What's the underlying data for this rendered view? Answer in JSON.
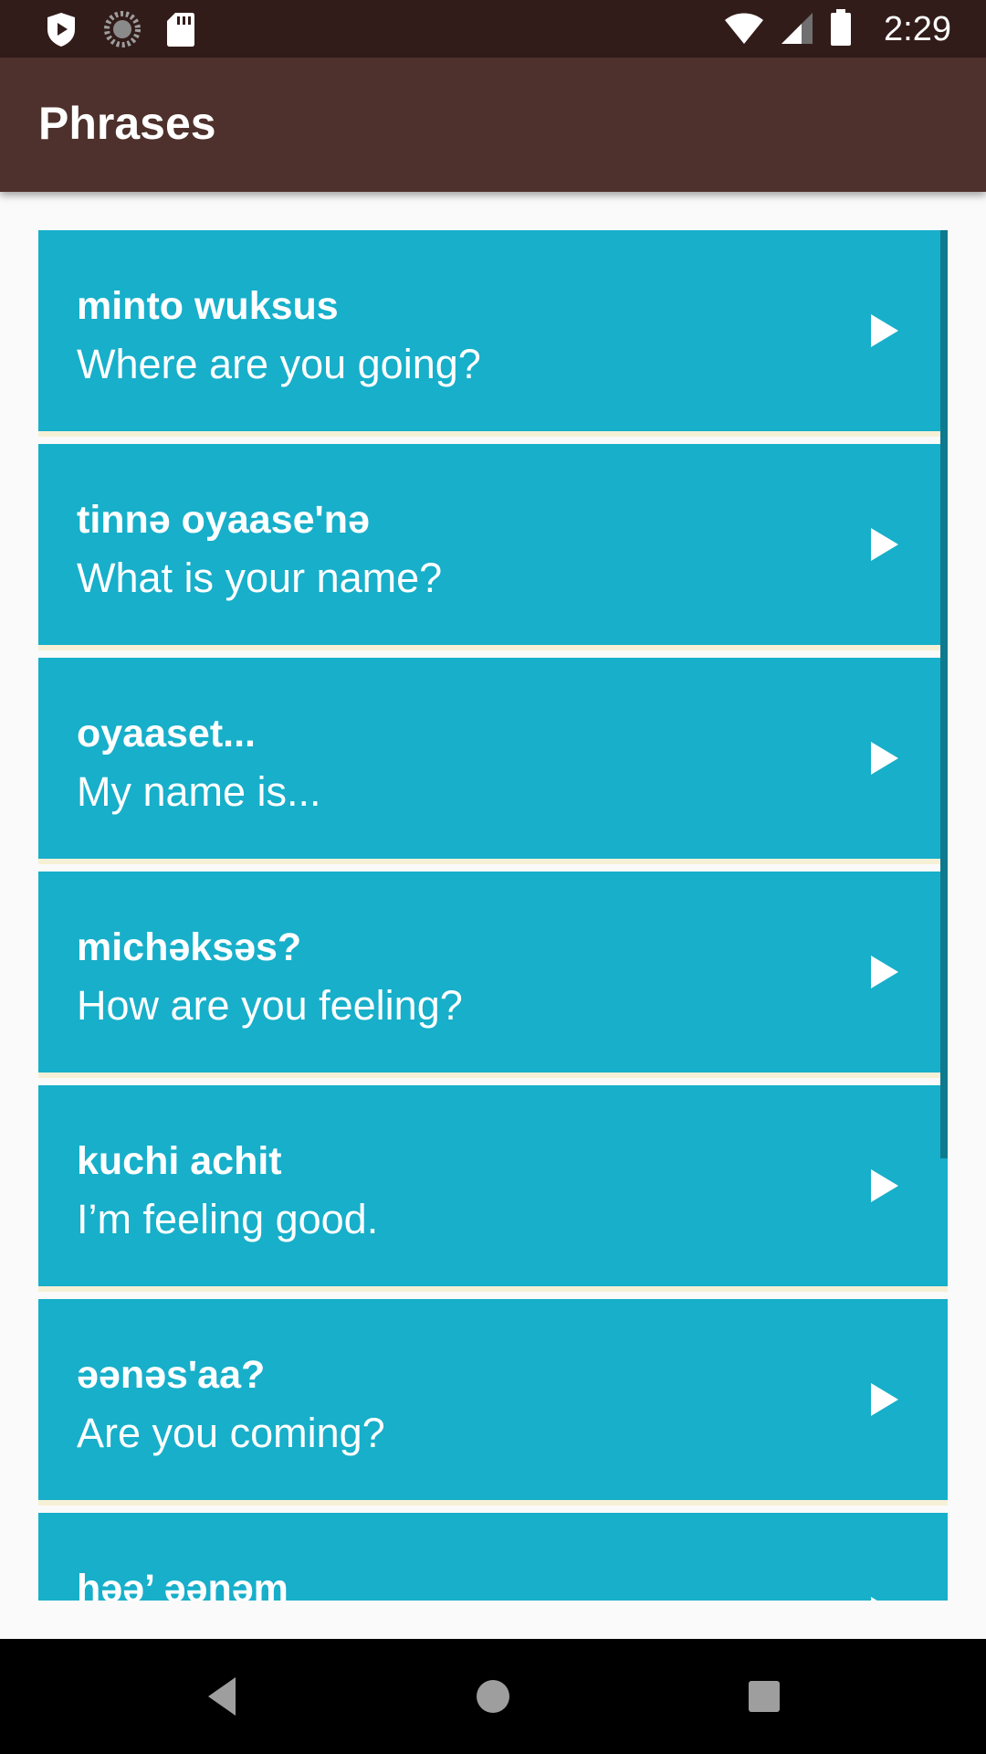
{
  "status_bar": {
    "time": "2:29",
    "icons_left": [
      "play-protect-icon",
      "loading-icon",
      "sd-card-icon"
    ],
    "icons_right": [
      "wifi-icon",
      "cell-signal-icon",
      "battery-icon"
    ]
  },
  "app_bar": {
    "title": "Phrases"
  },
  "phrases": [
    {
      "native": "minto wuksus",
      "english": "Where are you going?"
    },
    {
      "native": "tinnə oyaase'nə",
      "english": "What is your name?"
    },
    {
      "native": "oyaaset...",
      "english": "My name is..."
    },
    {
      "native": "michəksəs?",
      "english": "How are you feeling?"
    },
    {
      "native": "kuchi achit",
      "english": "I’m feeling good."
    },
    {
      "native": "əənəs'aa?",
      "english": "Are you coming?"
    },
    {
      "native": "həə’ əənəm",
      "english": ""
    }
  ],
  "nav_bar": {
    "buttons": [
      "back-icon",
      "home-icon",
      "recents-icon"
    ]
  },
  "colors": {
    "status_bar": "#321c1a",
    "app_bar": "#4e312c",
    "item_background": "#17afca",
    "item_separator": "#f6f0d6",
    "background": "#fafafa"
  }
}
